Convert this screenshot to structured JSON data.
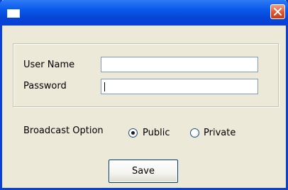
{
  "window": {
    "title": "",
    "close_icon": "close-icon"
  },
  "login": {
    "username_label": "User Name",
    "username_value": "",
    "password_label": "Password",
    "password_value": ""
  },
  "broadcast": {
    "label": "Broadcast Option",
    "options": [
      {
        "label": "Public",
        "selected": true
      },
      {
        "label": "Private",
        "selected": false
      }
    ]
  },
  "actions": {
    "save_label": "Save"
  },
  "colors": {
    "titlebar": "#0A5CEC",
    "window_bg": "#ECE9D8",
    "close_button": "#E2542E",
    "input_border": "#7F9DB9"
  }
}
